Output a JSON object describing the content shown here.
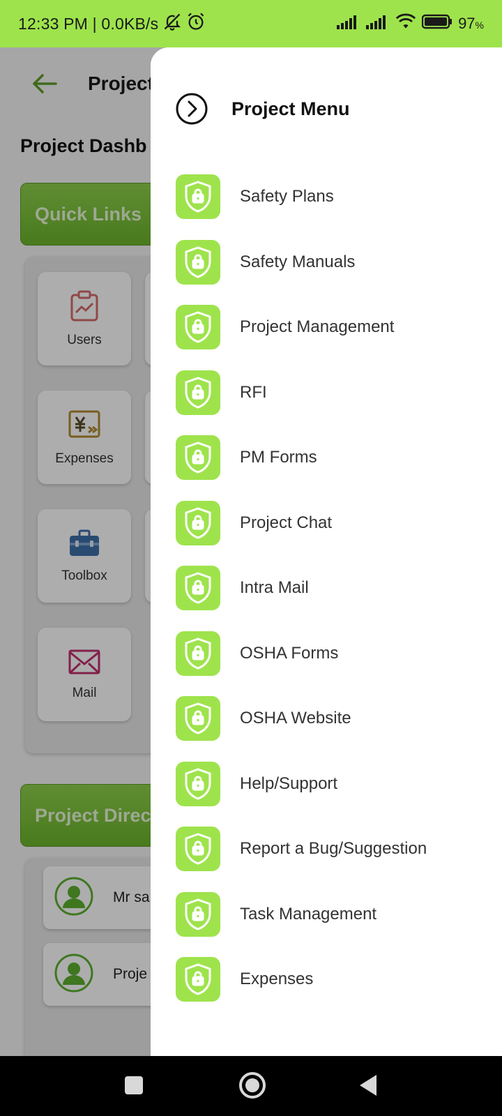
{
  "status_bar": {
    "time_speed": "12:33 PM | 0.0KB/s",
    "battery": "97",
    "battery_unit": "%"
  },
  "background": {
    "header_title": "Project",
    "dashboard_title": "Project Dashb",
    "quick_links_label": "Quick Links",
    "quick_links": [
      {
        "label": "Users",
        "icon": "clipboard-chart-icon"
      },
      {
        "label": "Expenses",
        "icon": "yen-transfer-icon"
      },
      {
        "label": "Toolbox",
        "icon": "toolbox-icon"
      },
      {
        "label": "Mail",
        "icon": "mail-icon"
      }
    ],
    "project_directory_label": "Project Direc",
    "directory_rows": [
      {
        "name": "Mr sa"
      },
      {
        "name": "Proje"
      }
    ]
  },
  "drawer": {
    "title": "Project Menu",
    "items": [
      {
        "label": "Safety Plans"
      },
      {
        "label": "Safety Manuals"
      },
      {
        "label": "Project Management"
      },
      {
        "label": "RFI"
      },
      {
        "label": "PM Forms"
      },
      {
        "label": "Project Chat"
      },
      {
        "label": "Intra Mail"
      },
      {
        "label": "OSHA Forms"
      },
      {
        "label": "OSHA Website"
      },
      {
        "label": "Help/Support"
      },
      {
        "label": "Report a Bug/Suggestion"
      },
      {
        "label": "Task Management"
      },
      {
        "label": "Expenses"
      }
    ],
    "item_icon": "shield-lock-icon"
  },
  "colors": {
    "accent": "#9ee34c",
    "status_bar": "#9ee34c",
    "nav_bar": "#000000"
  }
}
